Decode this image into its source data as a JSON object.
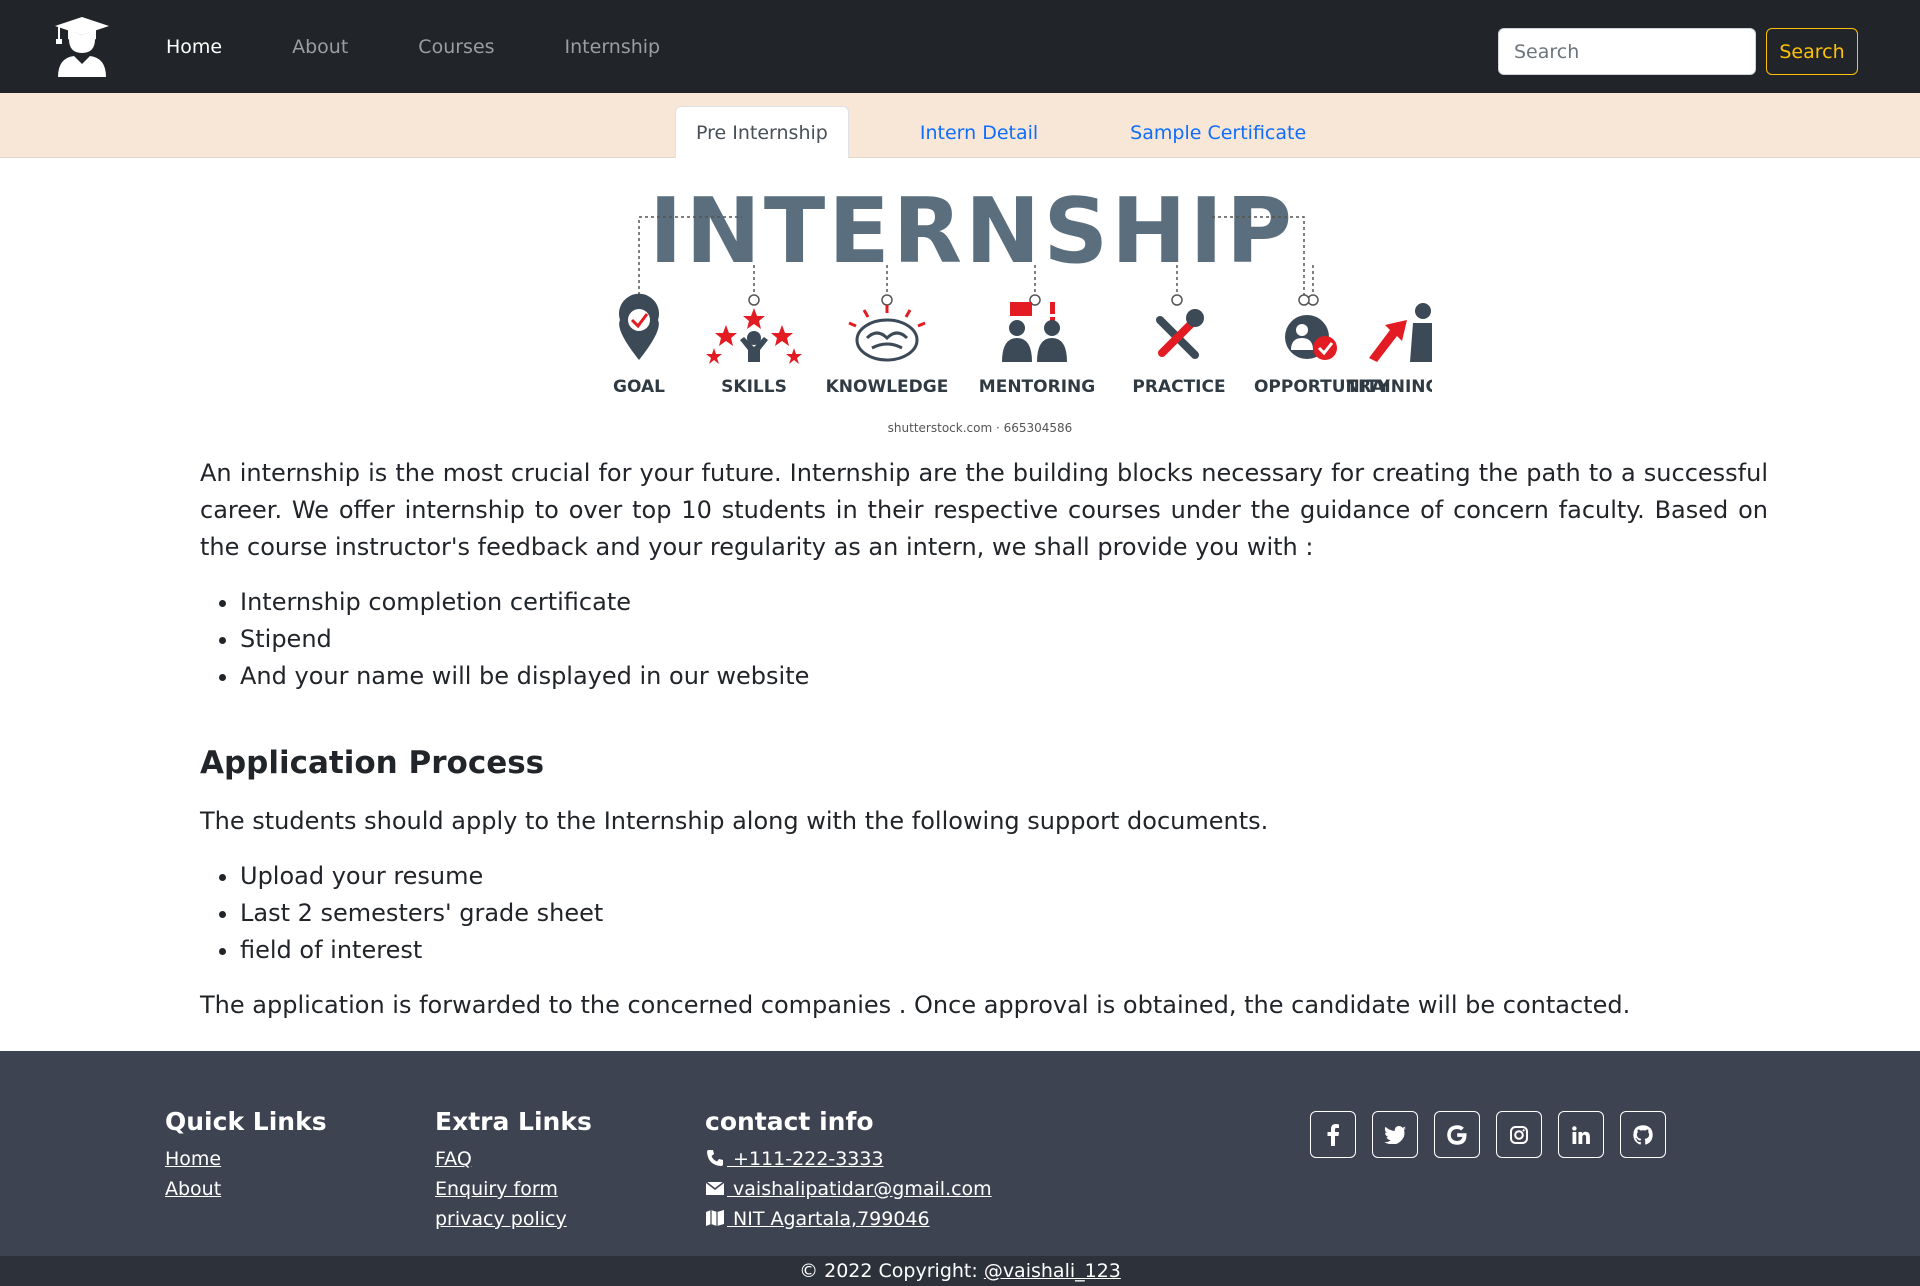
{
  "navbar": {
    "brand_icon": "graduate-icon",
    "links": [
      "Home",
      "About",
      "Courses",
      "Internship"
    ],
    "search_placeholder": "Search",
    "search_button": "Search"
  },
  "tabs": [
    "Pre Internship",
    "Intern Detail",
    "Sample Certificate"
  ],
  "hero": {
    "title": "INTERNSHIP",
    "labels": [
      "GOAL",
      "SKILLS",
      "KNOWLEDGE",
      "MENTORING",
      "PRACTICE",
      "OPPORTUNITY",
      "TRAINING"
    ],
    "credit": "shutterstock.com · 665304586"
  },
  "main": {
    "intro": "An internship is the most crucial for your future. Internship are the building blocks necessary for creating the path to a successful career. We offer internship to over top 10 students in their respective courses under the guidance of concern faculty. Based on the course instructor's feedback and your regularity as an intern, we shall provide you with :",
    "benefits": [
      "Internship completion certificate",
      "Stipend",
      "And your name will be displayed in our website"
    ],
    "process_heading": "Application Process",
    "process_intro": "The students should apply to the Internship along with the following support documents.",
    "documents": [
      "Upload your resume",
      "Last 2 semesters' grade sheet",
      "field of interest"
    ],
    "closing": "The application is forwarded to the concerned companies . Once approval is obtained, the candidate will be contacted."
  },
  "footer": {
    "quick_links": {
      "heading": "Quick Links",
      "items": [
        "Home",
        "About"
      ]
    },
    "extra_links": {
      "heading": "Extra Links",
      "items": [
        "FAQ",
        "Enquiry form",
        "privacy policy"
      ]
    },
    "contact": {
      "heading": "contact info",
      "phone": " +111-222-3333",
      "email": " vaishalipatidar@gmail.com",
      "address": " NIT Agartala,799046"
    },
    "socials": [
      "facebook-icon",
      "twitter-icon",
      "google-icon",
      "instagram-icon",
      "linkedin-icon",
      "github-icon"
    ],
    "copyright_prefix": "© 2022 Copyright: ",
    "copyright_handle": "@vaishali_123"
  },
  "colors": {
    "navbar_bg": "#212529",
    "tab_bar_bg": "#f8e6d6",
    "footer_bg": "#3d4350",
    "accent_yellow": "#ffc107",
    "link_blue": "#0d6efd",
    "hero_red": "#e31b23",
    "hero_slate": "#5a6e7d"
  }
}
